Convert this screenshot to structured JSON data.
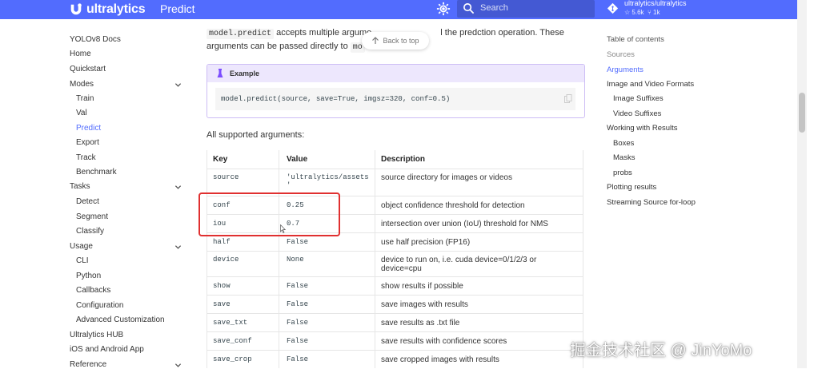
{
  "header": {
    "logo_text": "ultralytics",
    "page_name": "Predict",
    "search_placeholder": "Search",
    "repo_name": "ultralytics/ultralytics",
    "repo_stars": "5.6k",
    "repo_forks": "1k"
  },
  "nav": {
    "items": [
      {
        "label": "YOLOv8 Docs",
        "indent": false,
        "active": false
      },
      {
        "label": "Home",
        "indent": false,
        "active": false
      },
      {
        "label": "Quickstart",
        "indent": false,
        "active": false
      },
      {
        "label": "Modes",
        "indent": false,
        "active": false,
        "chevron": true
      },
      {
        "label": "Train",
        "indent": true,
        "active": false
      },
      {
        "label": "Val",
        "indent": true,
        "active": false
      },
      {
        "label": "Predict",
        "indent": true,
        "active": true
      },
      {
        "label": "Export",
        "indent": true,
        "active": false
      },
      {
        "label": "Track",
        "indent": true,
        "active": false
      },
      {
        "label": "Benchmark",
        "indent": true,
        "active": false
      },
      {
        "label": "Tasks",
        "indent": false,
        "active": false,
        "chevron": true
      },
      {
        "label": "Detect",
        "indent": true,
        "active": false
      },
      {
        "label": "Segment",
        "indent": true,
        "active": false
      },
      {
        "label": "Classify",
        "indent": true,
        "active": false
      },
      {
        "label": "Usage",
        "indent": false,
        "active": false,
        "chevron": true
      },
      {
        "label": "CLI",
        "indent": true,
        "active": false
      },
      {
        "label": "Python",
        "indent": true,
        "active": false
      },
      {
        "label": "Callbacks",
        "indent": true,
        "active": false
      },
      {
        "label": "Configuration",
        "indent": true,
        "active": false
      },
      {
        "label": "Advanced Customization",
        "indent": true,
        "active": false
      },
      {
        "label": "Ultralytics HUB",
        "indent": false,
        "active": false
      },
      {
        "label": "iOS and Android App",
        "indent": false,
        "active": false
      },
      {
        "label": "Reference",
        "indent": false,
        "active": false,
        "chevron": true
      }
    ]
  },
  "main": {
    "intro_code1": "model.predict",
    "intro_text1": " accepts multiple argume",
    "intro_text1b": "l the predction operation. These",
    "intro_text2": "arguments can be passed directly to ",
    "intro_code2": "mo",
    "back_to_top": "Back to top",
    "example_title": "Example",
    "example_code": "model.predict(source, save=True, imgsz=320, conf=0.5)",
    "supported_label": "All supported arguments:",
    "table": {
      "headers": [
        "Key",
        "Value",
        "Description"
      ],
      "rows": [
        {
          "key": "source",
          "value": "'ultralytics/assets\n'",
          "desc": "source directory for images or videos"
        },
        {
          "key": "conf",
          "value": "0.25",
          "desc": "object confidence threshold for detection"
        },
        {
          "key": "iou",
          "value": "0.7",
          "desc": "intersection over union (IoU) threshold for NMS"
        },
        {
          "key": "half",
          "value": "False",
          "desc": "use half precision (FP16)"
        },
        {
          "key": "device",
          "value": "None",
          "desc": "device to run on, i.e. cuda device=0/1/2/3 or\ndevice=cpu"
        },
        {
          "key": "show",
          "value": "False",
          "desc": "show results if possible"
        },
        {
          "key": "save",
          "value": "False",
          "desc": "save images with results"
        },
        {
          "key": "save_txt",
          "value": "False",
          "desc": "save results as .txt file"
        },
        {
          "key": "save_conf",
          "value": "False",
          "desc": "save results with confidence scores"
        },
        {
          "key": "save_crop",
          "value": "False",
          "desc": "save cropped images with results"
        }
      ]
    }
  },
  "toc": {
    "title": "Table of contents",
    "items": [
      {
        "label": "Sources",
        "indent": false,
        "state": "muted"
      },
      {
        "label": "Arguments",
        "indent": false,
        "state": "active"
      },
      {
        "label": "Image and Video Formats",
        "indent": false,
        "state": "normal"
      },
      {
        "label": "Image Suffixes",
        "indent": true,
        "state": "normal"
      },
      {
        "label": "Video Suffixes",
        "indent": true,
        "state": "normal"
      },
      {
        "label": "Working with Results",
        "indent": false,
        "state": "normal"
      },
      {
        "label": "Boxes",
        "indent": true,
        "state": "normal"
      },
      {
        "label": "Masks",
        "indent": true,
        "state": "normal"
      },
      {
        "label": "probs",
        "indent": true,
        "state": "normal"
      },
      {
        "label": "Plotting results",
        "indent": false,
        "state": "normal"
      },
      {
        "label": "Streaming Source for-loop",
        "indent": false,
        "state": "normal"
      }
    ]
  },
  "watermark": "掘金技术社区 @ JinYoMo",
  "colors": {
    "accent": "#526cfe",
    "highlight": "#e03030",
    "admonition": "#ede7fd"
  }
}
